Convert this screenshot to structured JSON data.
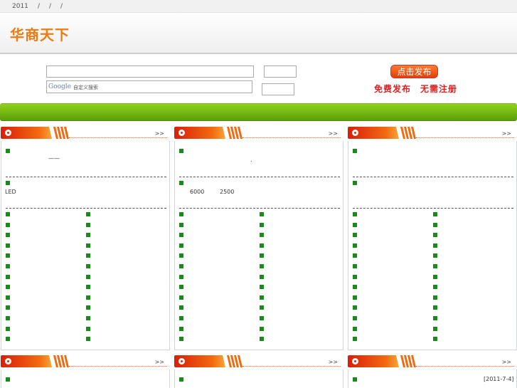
{
  "topbar": {
    "year": "2011",
    "sep1": "/",
    "sep2": "/",
    "sep3": "/"
  },
  "header": {
    "logo": "华商天下"
  },
  "search": {
    "google_logo": "Google",
    "google_placeholder": "自定义搜索",
    "publish_button": "点击发布",
    "publish_note": "免费发布　无需注册"
  },
  "panels": {
    "p1": {
      "more": ">>",
      "line_text": "——",
      "mid_text": "LED"
    },
    "p2": {
      "more": ">>",
      "dot_text": ".",
      "num1": "6000",
      "num2": "2500"
    },
    "p3": {
      "more": ">>"
    },
    "p4": {
      "more": ">>"
    },
    "p5": {
      "more": ">>"
    },
    "p6": {
      "more": ">>",
      "date": "[2011-7-4]"
    }
  },
  "colors": {
    "accent_orange": "#f07a0f",
    "green_bar": "#6cb412",
    "bullet_green": "#1a8a1a",
    "publish_red": "#e02020"
  }
}
